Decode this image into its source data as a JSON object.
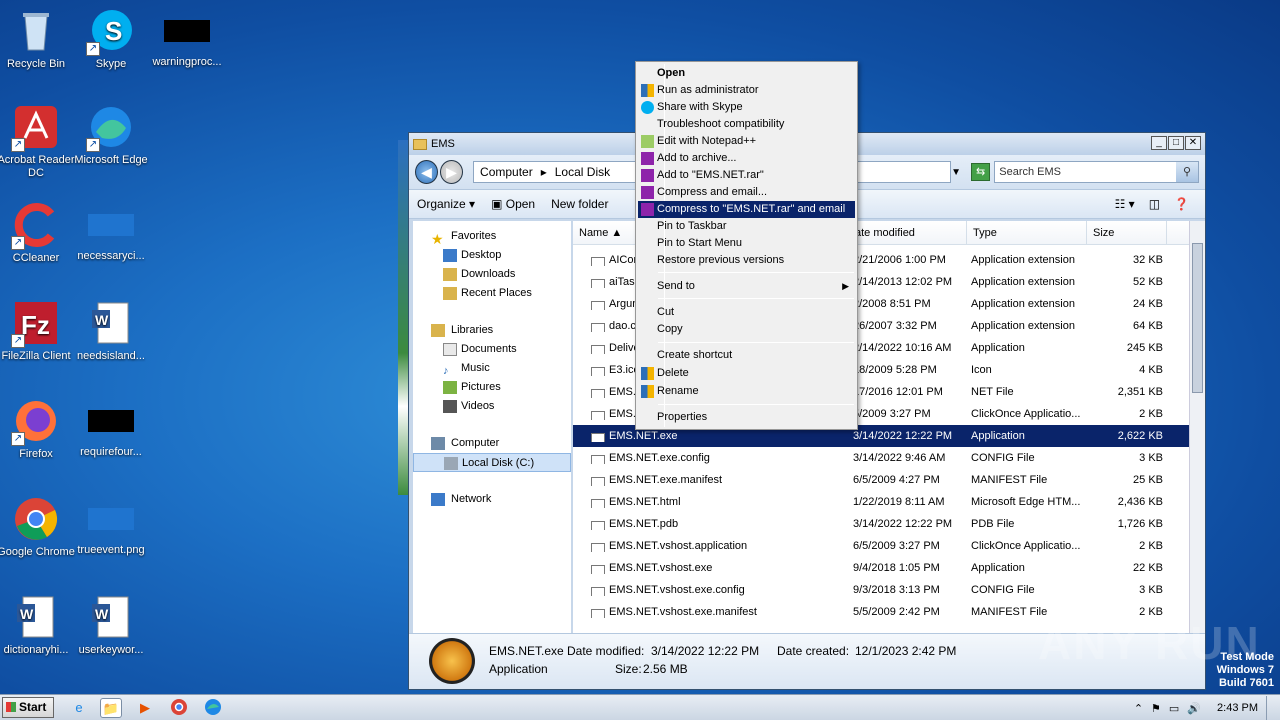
{
  "desktop": {
    "icons": [
      {
        "label": "Recycle Bin",
        "icon": "recycle-bin-icon"
      },
      {
        "label": "Skype",
        "icon": "skype-icon"
      },
      {
        "label": "warningproc...",
        "icon": "black-file-icon"
      },
      {
        "label": "Acrobat Reader DC",
        "icon": "acrobat-icon"
      },
      {
        "label": "Microsoft Edge",
        "icon": "edge-icon"
      },
      {
        "label": "CCleaner",
        "icon": "ccleaner-icon"
      },
      {
        "label": "necessaryci...",
        "icon": "blue-file-icon"
      },
      {
        "label": "FileZilla Client",
        "icon": "filezilla-icon"
      },
      {
        "label": "needsisland...",
        "icon": "word-doc-icon"
      },
      {
        "label": "Firefox",
        "icon": "firefox-icon"
      },
      {
        "label": "requirefour...",
        "icon": "black-file-icon"
      },
      {
        "label": "Google Chrome",
        "icon": "chrome-icon"
      },
      {
        "label": "trueevent.png",
        "icon": "blue-file-icon"
      },
      {
        "label": "dictionaryhi...",
        "icon": "word-doc-icon"
      },
      {
        "label": "userkeywor...",
        "icon": "word-doc-icon"
      }
    ]
  },
  "window": {
    "title": "EMS",
    "breadcrumb": [
      "Computer",
      "Local Disk"
    ],
    "search_placeholder": "Search EMS",
    "toolbar": {
      "organize": "Organize",
      "open": "Open",
      "new_folder": "New folder"
    },
    "nav": {
      "favorites": "Favorites",
      "desktop": "Desktop",
      "downloads": "Downloads",
      "recent": "Recent Places",
      "libraries": "Libraries",
      "documents": "Documents",
      "music": "Music",
      "pictures": "Pictures",
      "videos": "Videos",
      "computer": "Computer",
      "local_disk": "Local Disk (C:)",
      "network": "Network"
    },
    "columns": {
      "name": "Name",
      "date": "ate modified",
      "type": "Type",
      "size": "Size"
    },
    "rows": [
      {
        "name": "AICon",
        "date": "2/21/2006 1:00 PM",
        "type": "Application extension",
        "size": "32 KB"
      },
      {
        "name": "aiTasl",
        "date": "2/14/2013 12:02 PM",
        "type": "Application extension",
        "size": "52 KB"
      },
      {
        "name": "Argun",
        "date": "2/2008 8:51 PM",
        "type": "Application extension",
        "size": "24 KB"
      },
      {
        "name": "dao.c",
        "date": "26/2007 3:32 PM",
        "type": "Application extension",
        "size": "64 KB"
      },
      {
        "name": "Delive",
        "date": "2/14/2022 10:16 AM",
        "type": "Application",
        "size": "245 KB"
      },
      {
        "name": "E3.ico",
        "date": "18/2009 5:28 PM",
        "type": "Icon",
        "size": "4 KB"
      },
      {
        "name": "EMS.N",
        "date": "17/2016 12:01 PM",
        "type": "NET File",
        "size": "2,351 KB"
      },
      {
        "name": "EMS.N",
        "date": "5/2009 3:27 PM",
        "type": "ClickOnce Applicatio...",
        "size": "2 KB"
      },
      {
        "name": "EMS.NET.exe",
        "date": "3/14/2022 12:22 PM",
        "type": "Application",
        "size": "2,622 KB"
      },
      {
        "name": "EMS.NET.exe.config",
        "date": "3/14/2022 9:46 AM",
        "type": "CONFIG File",
        "size": "3 KB"
      },
      {
        "name": "EMS.NET.exe.manifest",
        "date": "6/5/2009 4:27 PM",
        "type": "MANIFEST File",
        "size": "25 KB"
      },
      {
        "name": "EMS.NET.html",
        "date": "1/22/2019 8:11 AM",
        "type": "Microsoft Edge HTM...",
        "size": "2,436 KB"
      },
      {
        "name": "EMS.NET.pdb",
        "date": "3/14/2022 12:22 PM",
        "type": "PDB File",
        "size": "1,726 KB"
      },
      {
        "name": "EMS.NET.vshost.application",
        "date": "6/5/2009 3:27 PM",
        "type": "ClickOnce Applicatio...",
        "size": "2 KB"
      },
      {
        "name": "EMS.NET.vshost.exe",
        "date": "9/4/2018 1:05 PM",
        "type": "Application",
        "size": "22 KB"
      },
      {
        "name": "EMS.NET.vshost.exe.config",
        "date": "9/3/2018 3:13 PM",
        "type": "CONFIG File",
        "size": "3 KB"
      },
      {
        "name": "EMS.NET.vshost.exe.manifest",
        "date": "5/5/2009 2:42 PM",
        "type": "MANIFEST File",
        "size": "2 KB"
      }
    ],
    "details": {
      "name": "EMS.NET.exe",
      "type": "Application",
      "modified_label": "Date modified:",
      "modified": "3/14/2022 12:22 PM",
      "size_label": "Size:",
      "size": "2.56 MB",
      "created_label": "Date created:",
      "created": "12/1/2023 2:42 PM"
    }
  },
  "context_menu": {
    "open": "Open",
    "run_admin": "Run as administrator",
    "share_skype": "Share with Skype",
    "troubleshoot": "Troubleshoot compatibility",
    "notepad": "Edit with Notepad++",
    "add_archive": "Add to archive...",
    "add_rar": "Add to \"EMS.NET.rar\"",
    "compress_email": "Compress and email...",
    "compress_rar_email": "Compress to \"EMS.NET.rar\" and email",
    "pin_taskbar": "Pin to Taskbar",
    "pin_start": "Pin to Start Menu",
    "restore": "Restore previous versions",
    "send_to": "Send to",
    "cut": "Cut",
    "copy": "Copy",
    "create_shortcut": "Create shortcut",
    "delete": "Delete",
    "rename": "Rename",
    "properties": "Properties"
  },
  "taskbar": {
    "start": "Start",
    "time": "2:43 PM"
  },
  "watermark": {
    "line1": "Test Mode",
    "line2": "Windows 7",
    "line3": "Build 7601",
    "brand": "ANY RUN"
  }
}
